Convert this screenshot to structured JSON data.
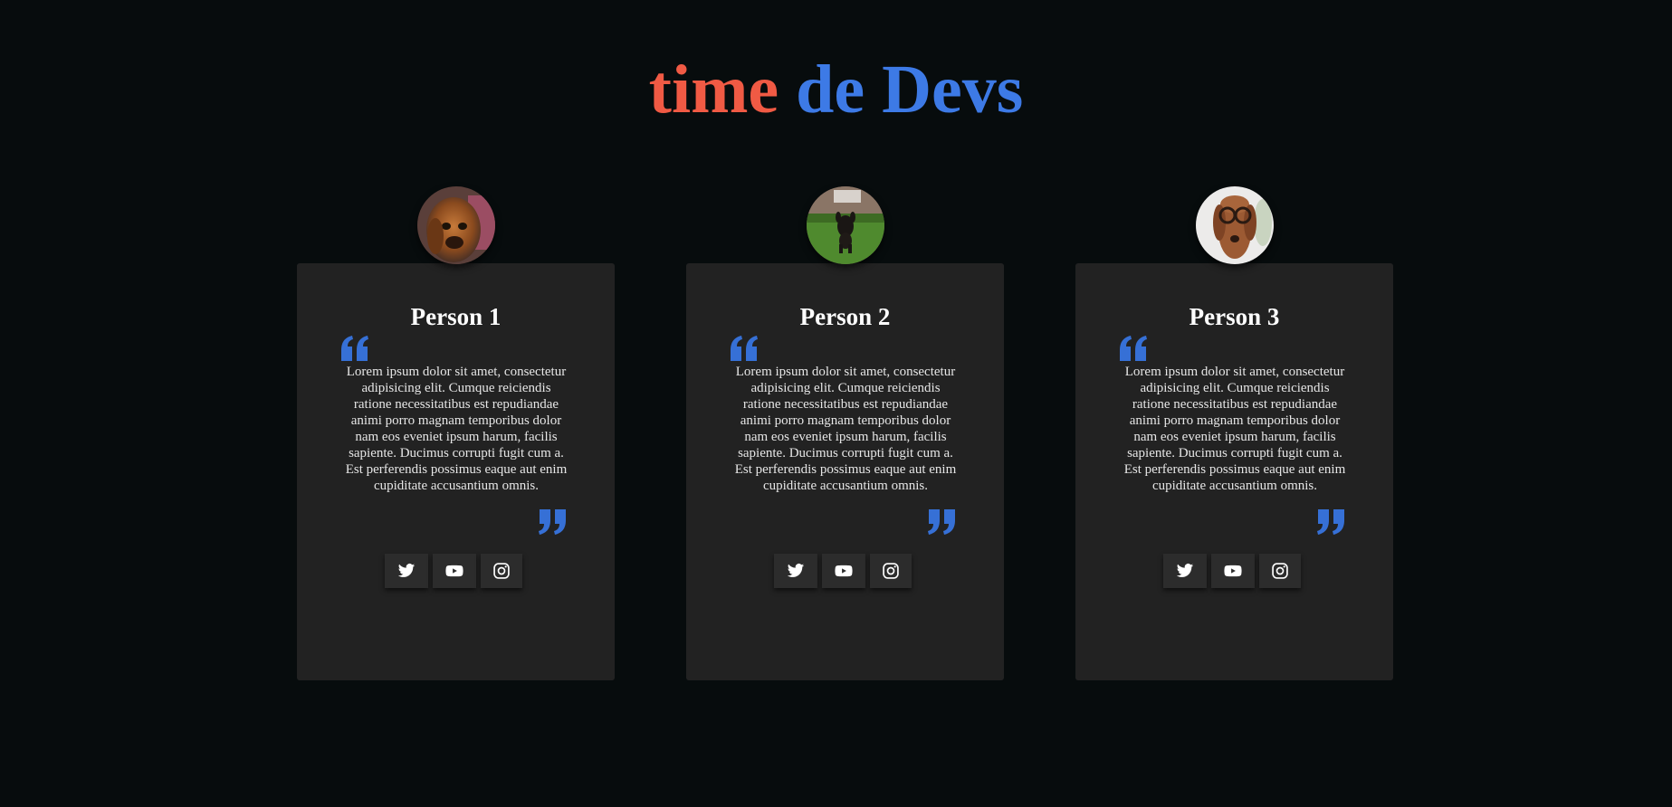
{
  "header": {
    "title_word1": "time",
    "title_word2": "de Devs",
    "color_word1": "#f05a44",
    "color_word2": "#3d7ae6"
  },
  "colors": {
    "background": "#070c0d",
    "card": "#222222",
    "accent": "#3d7ae6",
    "social_button": "#2c2c2c"
  },
  "cards": [
    {
      "name": "Person 1",
      "avatar_icon": "dog-photo-avatar",
      "bio": "Lorem ipsum dolor sit amet, consectetur adipisicing elit. Cumque reiciendis ratione necessitatibus est repudiandae animi porro magnam temporibus dolor nam eos eveniet ipsum harum, facilis sapiente. Ducimus corrupti fugit cum a. Est perferendis possimus eaque aut enim cupiditate accusantium omnis.",
      "socials": [
        "twitter-icon",
        "youtube-icon",
        "instagram-icon"
      ]
    },
    {
      "name": "Person 2",
      "avatar_icon": "dog-photo-avatar",
      "bio": "Lorem ipsum dolor sit amet, consectetur adipisicing elit. Cumque reiciendis ratione necessitatibus est repudiandae animi porro magnam temporibus dolor nam eos eveniet ipsum harum, facilis sapiente. Ducimus corrupti fugit cum a. Est perferendis possimus eaque aut enim cupiditate accusantium omnis.",
      "socials": [
        "twitter-icon",
        "youtube-icon",
        "instagram-icon"
      ]
    },
    {
      "name": "Person 3",
      "avatar_icon": "dog-photo-avatar",
      "bio": "Lorem ipsum dolor sit amet, consectetur adipisicing elit. Cumque reiciendis ratione necessitatibus est repudiandae animi porro magnam temporibus dolor nam eos eveniet ipsum harum, facilis sapiente. Ducimus corrupti fugit cum a. Est perferendis possimus eaque aut enim cupiditate accusantium omnis.",
      "socials": [
        "twitter-icon",
        "youtube-icon",
        "instagram-icon"
      ]
    }
  ]
}
